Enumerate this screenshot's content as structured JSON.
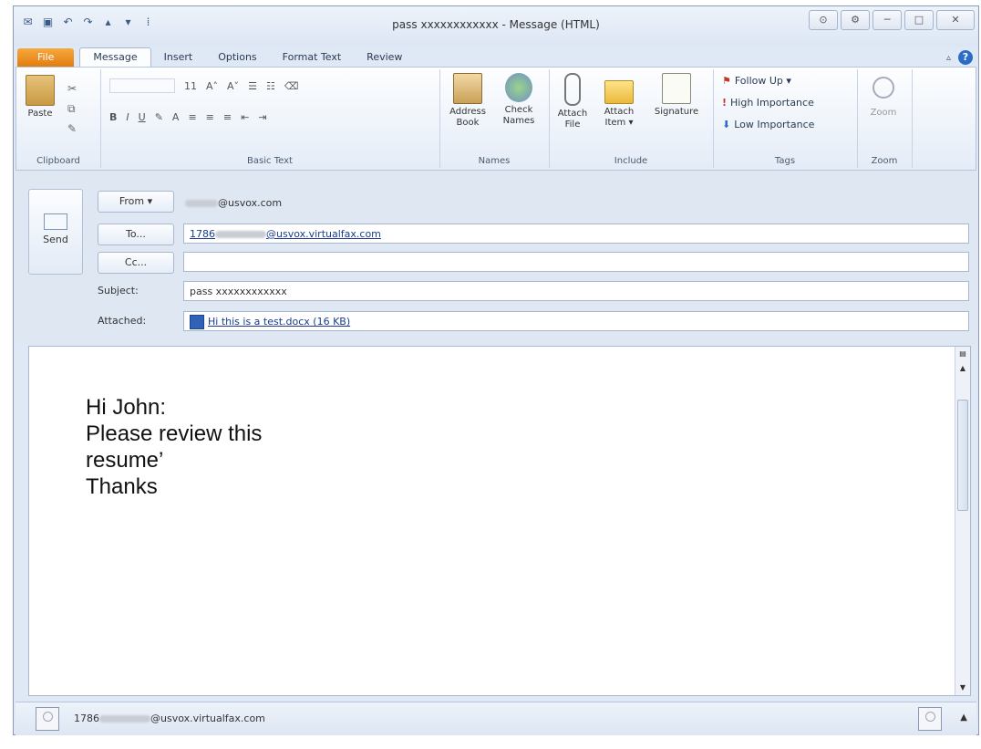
{
  "window": {
    "title": "pass xxxxxxxxxxxx - Message (HTML)",
    "buttons": [
      "⊙",
      "⚙",
      "─",
      "□",
      "✕"
    ]
  },
  "qat": {
    "icons": [
      "save-icon",
      "undo-icon",
      "redo-icon",
      "up-icon",
      "down-icon",
      "customize-icon"
    ]
  },
  "tabs": [
    "File",
    "Message",
    "Insert",
    "Options",
    "Format Text",
    "Review"
  ],
  "ribbon": {
    "clipboard": {
      "paste": "Paste",
      "label": "Clipboard"
    },
    "basic_text": {
      "font_size": "11",
      "bold": "B",
      "italic": "I",
      "underline": "U",
      "label": "Basic Text"
    },
    "names": {
      "address_book": "Address Book",
      "check_names": "Check Names",
      "label": "Names"
    },
    "include": {
      "attach_file": "Attach File",
      "attach_item": "Attach Item ▾",
      "signature": "Signature",
      "label": "Include"
    },
    "tags": {
      "follow_up": "Follow Up ▾",
      "high_importance": "High Importance",
      "low_importance": "Low Importance",
      "label": "Tags"
    },
    "zoom": {
      "zoom": "Zoom",
      "label": "Zoom"
    }
  },
  "header": {
    "send": "Send",
    "from_button": "From ▾",
    "from_value_suffix": "@usvox.com",
    "to_button": "To...",
    "to_prefix": "1786",
    "to_suffix": "@usvox.virtualfax.com",
    "cc_button": "Cc...",
    "subject_label": "Subject:",
    "subject_value": "pass xxxxxxxxxxxx",
    "attached_label": "Attached:",
    "attachment": "Hi this is a test.docx (16 KB)"
  },
  "body": {
    "lines": [
      "Hi John:",
      "Please review this",
      "resume’",
      "Thanks"
    ]
  },
  "people_pane": {
    "prefix": "1786",
    "suffix": "@usvox.virtualfax.com"
  }
}
